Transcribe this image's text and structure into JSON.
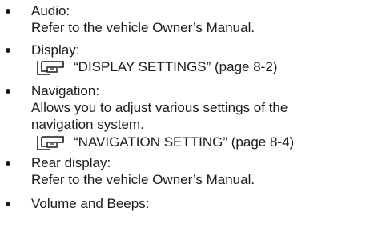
{
  "items": [
    {
      "heading": "Audio:",
      "lines": [
        "Refer to the vehicle Owner’s Manual."
      ]
    },
    {
      "heading": "Display:",
      "reference": "“DISPLAY SETTINGS” (page 8-2)"
    },
    {
      "heading": "Navigation:",
      "lines": [
        "Allows you to adjust various settings of the",
        "navigation system."
      ],
      "reference": "“NAVIGATION SETTING” (page 8-4)"
    },
    {
      "heading": "Rear display:",
      "lines": [
        "Refer to the vehicle Owner’s Manual."
      ]
    },
    {
      "heading": "Volume and Beeps:"
    }
  ],
  "icons": {
    "reference_icon": "reference-pointer-icon"
  }
}
